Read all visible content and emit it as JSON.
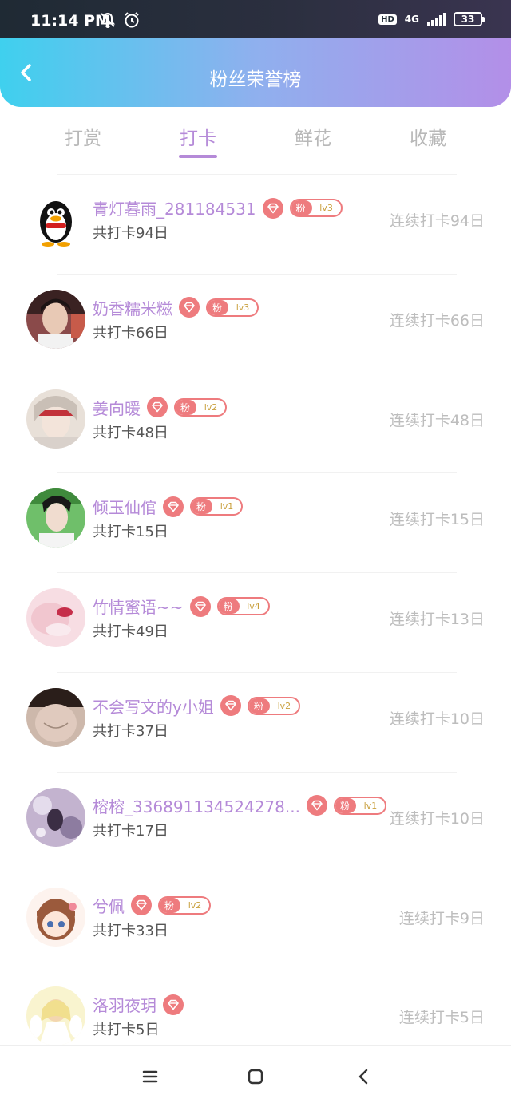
{
  "status_bar": {
    "time": "11:14 PM",
    "network": "4G",
    "hd": "HD",
    "battery": "33"
  },
  "header": {
    "title": "粉丝荣誉榜"
  },
  "tabs": [
    {
      "label": "打赏",
      "active": false
    },
    {
      "label": "打卡",
      "active": true
    },
    {
      "label": "鲜花",
      "active": false
    },
    {
      "label": "收藏",
      "active": false
    }
  ],
  "fan_badge_label": "粉",
  "colors": {
    "accent": "#b58ad8",
    "badge": "#ee7b7e",
    "level_text": "#c9a03e"
  },
  "list": [
    {
      "name": "青灯暮雨_281184531",
      "level": "lv3",
      "total": "共打卡94日",
      "streak": "连续打卡94日",
      "avatar": "penguin-avatar"
    },
    {
      "name": "奶香糯米糍",
      "level": "lv3",
      "total": "共打卡66日",
      "streak": "连续打卡66日",
      "avatar": "boy-photo-avatar"
    },
    {
      "name": "姜向暖",
      "level": "lv2",
      "total": "共打卡48日",
      "streak": "连续打卡48日",
      "avatar": "girl-photo-avatar"
    },
    {
      "name": "倾玉仙倌",
      "level": "lv1",
      "total": "共打卡15日",
      "streak": "连续打卡15日",
      "avatar": "actor-photo-avatar"
    },
    {
      "name": "竹情蜜语~~",
      "level": "lv4",
      "total": "共打卡49日",
      "streak": "连续打卡13日",
      "avatar": "pink-photo-avatar"
    },
    {
      "name": "不会写文的y小姐",
      "level": "lv2",
      "total": "共打卡37日",
      "streak": "连续打卡10日",
      "avatar": "neck-photo-avatar"
    },
    {
      "name": "榕榕_336891134524278...",
      "level": "lv1",
      "total": "共打卡17日",
      "streak": "连续打卡10日",
      "avatar": "purple-photo-avatar"
    },
    {
      "name": "兮佩",
      "level": "lv2",
      "total": "共打卡33日",
      "streak": "连续打卡9日",
      "avatar": "anime-girl-avatar"
    },
    {
      "name": "洛羽夜玥",
      "level": "",
      "total": "共打卡5日",
      "streak": "连续打卡5日",
      "avatar": "anime-angel-avatar"
    }
  ]
}
